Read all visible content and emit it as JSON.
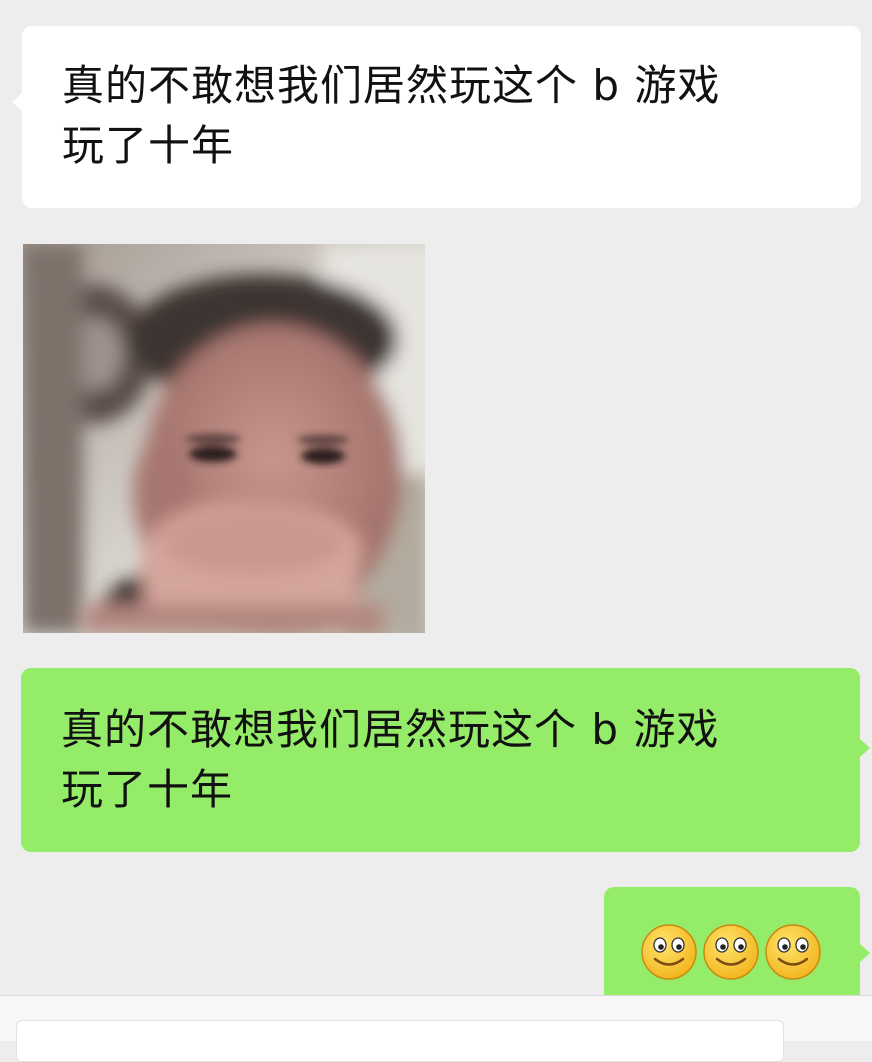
{
  "messages": [
    {
      "direction": "incoming",
      "type": "text",
      "line1": "真的不敢想我们居然玩这个 b 游戏",
      "line2": "玩了十年"
    },
    {
      "direction": "incoming",
      "type": "image",
      "image_subject": "blurry photo of a person covering their mouth with a hand"
    },
    {
      "direction": "outgoing",
      "type": "text",
      "line1": "真的不敢想我们居然玩这个 b 游戏",
      "line2": "玩了十年"
    },
    {
      "direction": "outgoing",
      "type": "emoji",
      "emoji_name": "smiley-face-icon",
      "emoji_count": 3
    }
  ],
  "input": {
    "value": ""
  },
  "colors": {
    "background": "#ededed",
    "incoming_bubble": "#ffffff",
    "outgoing_bubble": "#95ec69",
    "text": "#111111"
  }
}
